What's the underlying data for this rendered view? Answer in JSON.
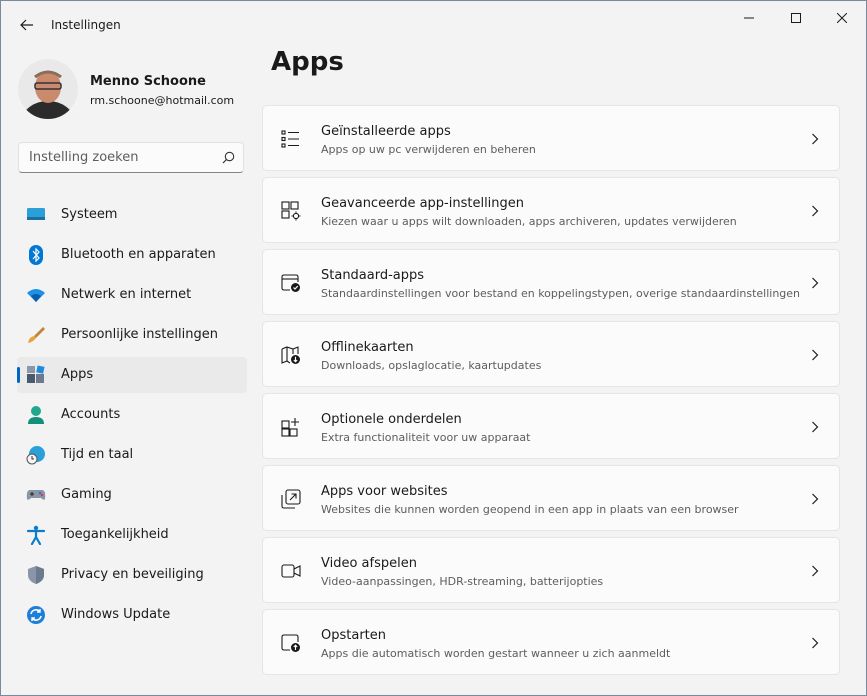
{
  "window": {
    "title": "Instellingen"
  },
  "profile": {
    "name": "Menno Schoone",
    "email": "rm.schoone@hotmail.com"
  },
  "search": {
    "placeholder": "Instelling zoeken"
  },
  "nav": {
    "active_index": 4,
    "items": [
      {
        "label": "Systeem",
        "icon": "monitor-icon"
      },
      {
        "label": "Bluetooth en apparaten",
        "icon": "bluetooth-icon"
      },
      {
        "label": "Netwerk en internet",
        "icon": "wifi-icon"
      },
      {
        "label": "Persoonlijke instellingen",
        "icon": "brush-icon"
      },
      {
        "label": "Apps",
        "icon": "apps-icon"
      },
      {
        "label": "Accounts",
        "icon": "person-icon"
      },
      {
        "label": "Tijd en taal",
        "icon": "globe-clock-icon"
      },
      {
        "label": "Gaming",
        "icon": "gamepad-icon"
      },
      {
        "label": "Toegankelijkheid",
        "icon": "accessibility-icon"
      },
      {
        "label": "Privacy en beveiliging",
        "icon": "shield-icon"
      },
      {
        "label": "Windows Update",
        "icon": "update-icon"
      }
    ]
  },
  "page": {
    "title": "Apps"
  },
  "cards": [
    {
      "title": "Geïnstalleerde apps",
      "description": "Apps op uw pc verwijderen en beheren",
      "icon": "list-icon"
    },
    {
      "title": "Geavanceerde app-instellingen",
      "description": "Kiezen waar u apps wilt downloaden, apps archiveren, updates verwijderen",
      "icon": "app-settings-icon"
    },
    {
      "title": "Standaard-apps",
      "description": "Standaardinstellingen voor bestand en koppelingstypen, overige standaardinstellingen",
      "icon": "default-apps-icon"
    },
    {
      "title": "Offlinekaarten",
      "description": "Downloads, opslaglocatie, kaartupdates",
      "icon": "map-download-icon"
    },
    {
      "title": "Optionele onderdelen",
      "description": "Extra functionaliteit voor uw apparaat",
      "icon": "add-features-icon"
    },
    {
      "title": "Apps voor websites",
      "description": "Websites die kunnen worden geopend in een app in plaats van een browser",
      "icon": "open-in-app-icon"
    },
    {
      "title": "Video afspelen",
      "description": "Video-aanpassingen, HDR-streaming, batterijopties",
      "icon": "video-icon"
    },
    {
      "title": "Opstarten",
      "description": "Apps die automatisch worden gestart wanneer u zich aanmeldt",
      "icon": "startup-icon"
    }
  ],
  "colors": {
    "accent": "#0067c0",
    "background": "#f3f3f3",
    "card": "#fbfbfb"
  }
}
